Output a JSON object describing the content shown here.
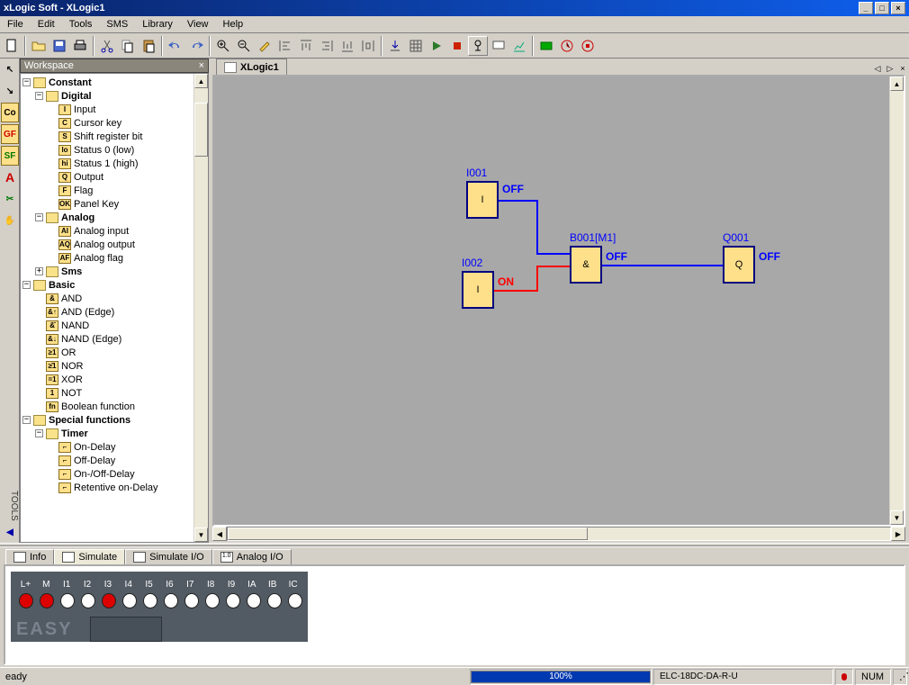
{
  "app_title": "xLogic Soft - XLogic1",
  "menubar": [
    "File",
    "Edit",
    "Tools",
    "SMS",
    "Library",
    "View",
    "Help"
  ],
  "workspace_title": "Workspace",
  "doc_tab": "XLogic1",
  "tree": {
    "constant": "Constant",
    "digital": "Digital",
    "digital_items": [
      {
        "ico": "I",
        "lbl": "Input"
      },
      {
        "ico": "C",
        "lbl": "Cursor key"
      },
      {
        "ico": "S",
        "lbl": "Shift register bit"
      },
      {
        "ico": "lo",
        "lbl": "Status 0 (low)"
      },
      {
        "ico": "hi",
        "lbl": "Status 1 (high)"
      },
      {
        "ico": "Q",
        "lbl": "Output"
      },
      {
        "ico": "F",
        "lbl": "Flag"
      },
      {
        "ico": "OK",
        "lbl": "Panel Key"
      }
    ],
    "analog": "Analog",
    "analog_items": [
      {
        "ico": "AI",
        "lbl": "Analog input"
      },
      {
        "ico": "AQ",
        "lbl": "Analog output"
      },
      {
        "ico": "AF",
        "lbl": "Analog flag"
      }
    ],
    "sms": "Sms",
    "basic": "Basic",
    "basic_items": [
      {
        "ico": "&",
        "lbl": "AND"
      },
      {
        "ico": "&↑",
        "lbl": "AND (Edge)"
      },
      {
        "ico": "&̄",
        "lbl": "NAND"
      },
      {
        "ico": "&↓",
        "lbl": "NAND (Edge)"
      },
      {
        "ico": "≥1",
        "lbl": "OR"
      },
      {
        "ico": "≥̄1",
        "lbl": "NOR"
      },
      {
        "ico": "=1",
        "lbl": "XOR"
      },
      {
        "ico": "1",
        "lbl": "NOT"
      },
      {
        "ico": "fn",
        "lbl": "Boolean function"
      }
    ],
    "special": "Special functions",
    "timer": "Timer",
    "timer_items": [
      {
        "ico": "⌐",
        "lbl": "On-Delay"
      },
      {
        "ico": "⌐",
        "lbl": "Off-Delay"
      },
      {
        "ico": "⌐",
        "lbl": "On-/Off-Delay"
      },
      {
        "ico": "⌐",
        "lbl": "Retentive on-Delay"
      }
    ]
  },
  "blocks": {
    "i001": {
      "label": "I001",
      "sym": "I",
      "pin": "OFF"
    },
    "i002": {
      "label": "I002",
      "sym": "I",
      "pin": "ON"
    },
    "b001": {
      "label": "B001[M1]",
      "sym": "&",
      "pin": "OFF"
    },
    "q001": {
      "label": "Q001",
      "sym": "Q",
      "pin": "OFF"
    }
  },
  "bottom_tabs": {
    "info": "Info",
    "simulate": "Simulate",
    "simulate_io": "Simulate I/O",
    "analog_io": "Analog I/O"
  },
  "io": {
    "headers": [
      "L+",
      "M",
      "I1",
      "I2",
      "I3",
      "I4",
      "I5",
      "I6",
      "I7",
      "I8",
      "I9",
      "IA",
      "IB",
      "IC"
    ],
    "leds": [
      true,
      true,
      false,
      false,
      true,
      false,
      false,
      false,
      false,
      false,
      false,
      false,
      false,
      false
    ],
    "brand": "EASY"
  },
  "statusbar": {
    "ready": "eady",
    "progress": "100%",
    "model": "ELC-18DC-DA-R-U",
    "num": "NUM"
  },
  "tools_label": "TOOLS"
}
